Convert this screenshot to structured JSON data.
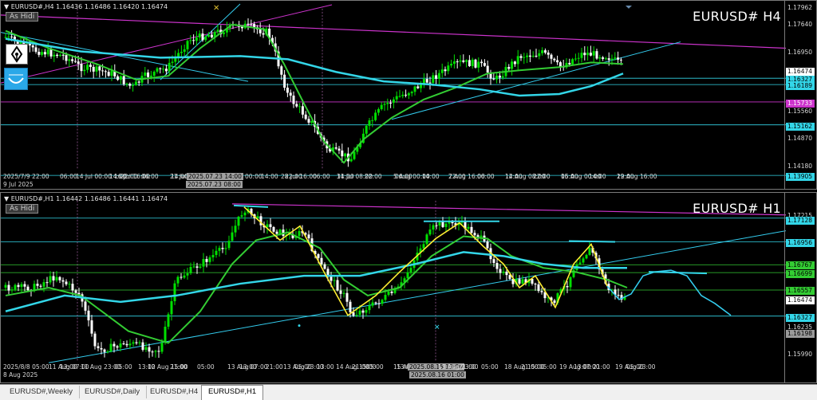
{
  "top_panel": {
    "ohlc": "▼ EURUSD#,H4  1.16436 1.16486 1.16420 1.16474",
    "as_hidi": "As Hidi",
    "symbol": "EURUSD# H4",
    "price_labels": [
      {
        "text": "1.17962",
        "style": "plain"
      },
      {
        "text": "1.17640",
        "style": "plain"
      },
      {
        "text": "1.16950",
        "style": "plain"
      },
      {
        "text": "1.16474",
        "style": "white"
      },
      {
        "text": "1.16327",
        "style": "cyan"
      },
      {
        "text": "1.16189",
        "style": "cyan"
      },
      {
        "text": "1.15733",
        "style": "magenta"
      },
      {
        "text": "1.15560",
        "style": "plain"
      },
      {
        "text": "1.15162",
        "style": "cyan"
      },
      {
        "text": "1.14870",
        "style": "plain"
      },
      {
        "text": "1.14180",
        "style": "plain"
      },
      {
        "text": "1.13905",
        "style": "cyan"
      }
    ],
    "time_labels": [
      "9 Jul 2025",
      "2025/7/9 22:00",
      "06:00",
      "14 Jul 00:00",
      "14:00",
      "16 Jul 16:00",
      "22:00",
      "06:00",
      "14:00",
      "21 Jul",
      "2025.07.23 14:00",
      "2025.07.23 08:00",
      "00:00",
      "14:00",
      "22:00",
      "28 Jul 16:00",
      "06:00",
      "14:00",
      "31 Jul 08:00",
      "22:00",
      "06:00",
      "5 Aug 00:00",
      "14:00",
      "22:00",
      "7 Aug 16:00",
      "06:00",
      "14:00",
      "12 Aug 08:00",
      "22:00",
      "06:00",
      "15 Aug 00:00",
      "14:00",
      "22:00",
      "19 Aug 16:00"
    ]
  },
  "bottom_panel": {
    "ohlc": "▼ EURUSD#,H1  1.16442 1.16486 1.16441 1.16474",
    "as_hidi": "As Hidi",
    "symbol": "EURUSD# H1",
    "price_labels": [
      {
        "text": "1.17215",
        "style": "plain"
      },
      {
        "text": "1.17128",
        "style": "cyan"
      },
      {
        "text": "1.16956",
        "style": "cyan"
      },
      {
        "text": "1.16767",
        "style": "green"
      },
      {
        "text": "1.16699",
        "style": "green"
      },
      {
        "text": "1.16557",
        "style": "green"
      },
      {
        "text": "1.16474",
        "style": "white"
      },
      {
        "text": "1.16327",
        "style": "cyan"
      },
      {
        "text": "1.16235",
        "style": "plain"
      },
      {
        "text": "1.16198",
        "style": "gray"
      },
      {
        "text": "1.15990",
        "style": "plain"
      }
    ],
    "time_labels": [
      "8 Aug 2025",
      "2025/8/8 05:00",
      "11 Aug 07:00",
      "13:00",
      "11 Aug 23:00",
      "05:00",
      "13:00",
      "12 Aug 15:00",
      "21:00",
      "05:00",
      "13 Aug 07:00",
      "13:00",
      "21:00",
      "13 Aug 23:00",
      "05:00",
      "13:00",
      "14 Aug 15:00",
      "21:00",
      "05:00",
      "15 Aug",
      "13:00",
      "2025.08.16 01:00",
      "2025.08.15 19:00",
      "13 Aug 23:00",
      "21:00",
      "05:00",
      "18 Aug 15:00",
      "21:00",
      "05:00",
      "19 Aug 07:00",
      "13:00",
      "21:00",
      "19 Aug 23:00",
      "05:00"
    ]
  },
  "tabs": [
    {
      "label": "EURUSD#,Weekly",
      "active": false
    },
    {
      "label": "EURUSD#,Daily",
      "active": false
    },
    {
      "label": "EURUSD#,H4",
      "active": false
    },
    {
      "label": "EURUSD#,H1",
      "active": true
    }
  ],
  "colors": {
    "bull_candle": "#00e000",
    "bear_candle": "#ffffff",
    "ma_fast": "#33cc33",
    "ma_slow": "#33d6e8",
    "trend_magenta": "#cc33cc",
    "trend_cyan": "#33ccee",
    "zigzag": "#ffee33",
    "forecast": "#33ccee"
  }
}
